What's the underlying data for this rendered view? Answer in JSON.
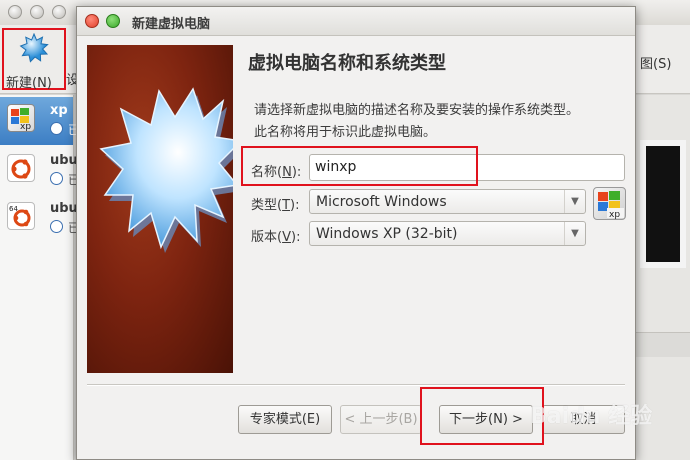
{
  "main_window": {
    "toolbar": {
      "new_label": "新建(N)",
      "right_peek_label": "图(S)",
      "left_peek_glyph": "设"
    },
    "vm_list": [
      {
        "name": "xp",
        "state_glyph": "已",
        "badge": "xp",
        "selected": true
      },
      {
        "name": "ubu",
        "state_glyph": "已",
        "badge": "",
        "selected": false
      },
      {
        "name": "ubu",
        "state_glyph": "已",
        "badge": "64",
        "selected": false
      }
    ]
  },
  "dialog": {
    "title": "新建虚拟电脑",
    "heading": "虚拟电脑名称和系统类型",
    "description_lines": [
      "请选择新虚拟电脑的描述名称及要安装的操作系统类型。",
      "此名称将用于标识此虚拟电脑。"
    ],
    "fields": {
      "name": {
        "label": "名称",
        "mnemonic": "N",
        "value": "winxp"
      },
      "type": {
        "label": "类型",
        "mnemonic": "T",
        "value": "Microsoft Windows"
      },
      "version": {
        "label": "版本",
        "mnemonic": "V",
        "value": "Windows XP (32-bit)"
      }
    },
    "buttons": {
      "expert": "专家模式(E)",
      "back": "< 上一步(B)",
      "next": "下一步(N) >",
      "cancel": "取消"
    }
  },
  "watermark": "Baidu 经验",
  "colors": {
    "highlight": "#e0121d",
    "selection": "#3c7ec4",
    "banner": "#7e2410"
  }
}
